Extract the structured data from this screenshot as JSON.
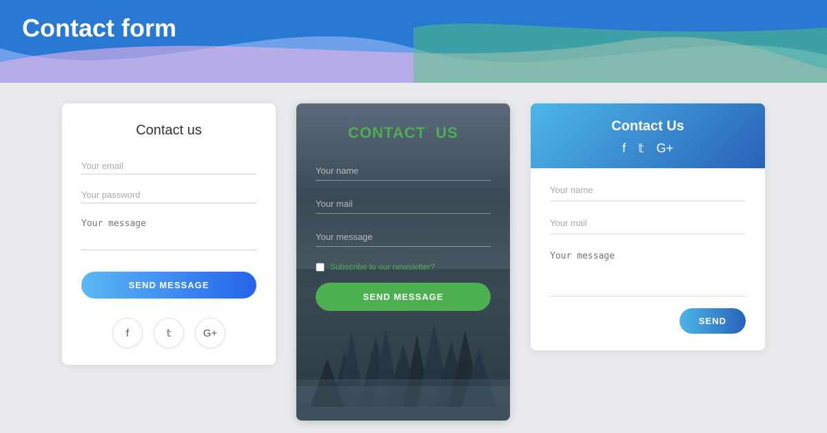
{
  "header": {
    "title": "Contact form"
  },
  "card1": {
    "title": "Contact us",
    "email_placeholder": "Your email",
    "password_placeholder": "Your password",
    "message_placeholder": "Your message",
    "send_button": "SEND MESSAGE"
  },
  "card2": {
    "title_white": "CONTACT",
    "title_green": "US",
    "name_placeholder": "Your name",
    "mail_placeholder": "Your mail",
    "message_placeholder": "Your message",
    "subscribe_text": "Subscribe to our ",
    "subscribe_link": "newsletter?",
    "send_button": "SEND MESSAGE"
  },
  "card3": {
    "title": "Contact Us",
    "name_placeholder": "Your name",
    "mail_placeholder": "Your mail",
    "message_placeholder": "Your message",
    "send_button": "SEND",
    "social": [
      "f",
      "𝕥",
      "G+"
    ]
  },
  "colors": {
    "blue_gradient_start": "#4db6e8",
    "blue_gradient_end": "#2962b8",
    "green": "#4caf50",
    "header_blue": "#2979d4"
  }
}
